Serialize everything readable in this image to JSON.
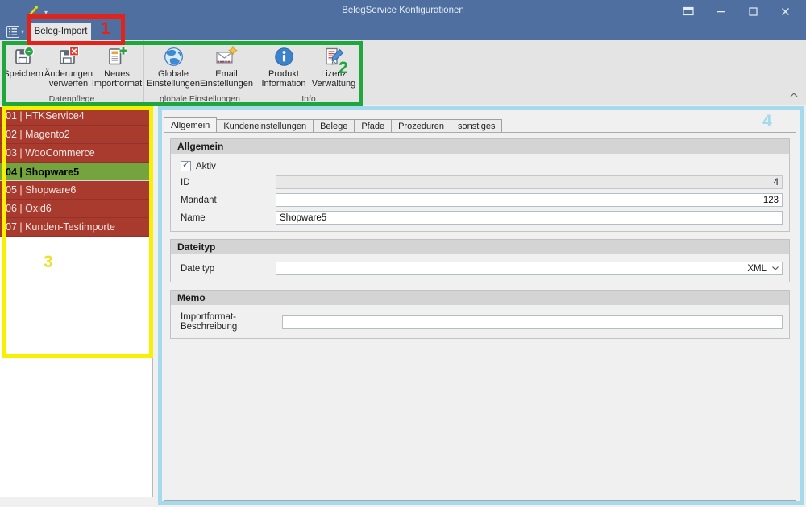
{
  "titlebar": {
    "title": "BelegService Konfigurationen"
  },
  "ribbon_tab": {
    "label": "Beleg-Import"
  },
  "ribbon": {
    "groups": [
      {
        "label": "Datenpflege",
        "buttons": [
          {
            "label": "Speichern",
            "icon": "save-icon"
          },
          {
            "label": "Änderungen verwerfen",
            "icon": "discard-changes-icon"
          },
          {
            "label": "Neues Importformat",
            "icon": "new-importformat-icon"
          }
        ]
      },
      {
        "label": "globale Einstellungen",
        "buttons": [
          {
            "label": "Globale Einstellungen",
            "icon": "globe-icon"
          },
          {
            "label": "Email Einstellungen",
            "icon": "email-icon"
          }
        ]
      },
      {
        "label": "Info",
        "buttons": [
          {
            "label": "Produkt Information",
            "icon": "info-icon"
          },
          {
            "label": "Lizenz Verwaltung",
            "icon": "license-icon"
          }
        ]
      }
    ]
  },
  "sidebar": {
    "items": [
      {
        "label": "01 | HTKService4",
        "selected": false
      },
      {
        "label": "02 | Magento2",
        "selected": false
      },
      {
        "label": "03 | WooCommerce",
        "selected": false
      },
      {
        "label": "04 | Shopware5",
        "selected": true
      },
      {
        "label": "05 | Shopware6",
        "selected": false
      },
      {
        "label": "06 | Oxid6",
        "selected": false
      },
      {
        "label": "07 | Kunden-Testimporte",
        "selected": false
      }
    ]
  },
  "tabs": [
    {
      "label": "Allgemein",
      "active": true
    },
    {
      "label": "Kundeneinstellungen",
      "active": false
    },
    {
      "label": "Belege",
      "active": false
    },
    {
      "label": "Pfade",
      "active": false
    },
    {
      "label": "Prozeduren",
      "active": false
    },
    {
      "label": "sonstiges",
      "active": false
    }
  ],
  "form": {
    "allgemein": {
      "title": "Allgemein",
      "aktiv_label": "Aktiv",
      "aktiv_checked": true,
      "check_glyph": "✓",
      "id_label": "ID",
      "id_value": "4",
      "mandant_label": "Mandant",
      "mandant_value": "123",
      "name_label": "Name",
      "name_value": "Shopware5"
    },
    "dateityp": {
      "title": "Dateityp",
      "label": "Dateityp",
      "value": "XML"
    },
    "memo": {
      "title": "Memo",
      "label": "Importformat-Beschreibung",
      "value": ""
    }
  },
  "annotations": [
    {
      "number": "1",
      "color": "#e0241b",
      "target": "ribbon-tab"
    },
    {
      "number": "2",
      "color": "#1fa63c",
      "target": "ribbon-buttons"
    },
    {
      "number": "3",
      "color": "#f7f000",
      "target": "importformat-list"
    },
    {
      "number": "4",
      "color": "#a5d9ec",
      "target": "detail-area"
    }
  ],
  "colors": {
    "titlebar_blue": "#4e6f9f",
    "list_item_red": "#a93a2e",
    "list_selected_green": "#73a43d",
    "ribbon_bg": "#e4e4e4",
    "panel_bg": "#f0f0f0"
  }
}
